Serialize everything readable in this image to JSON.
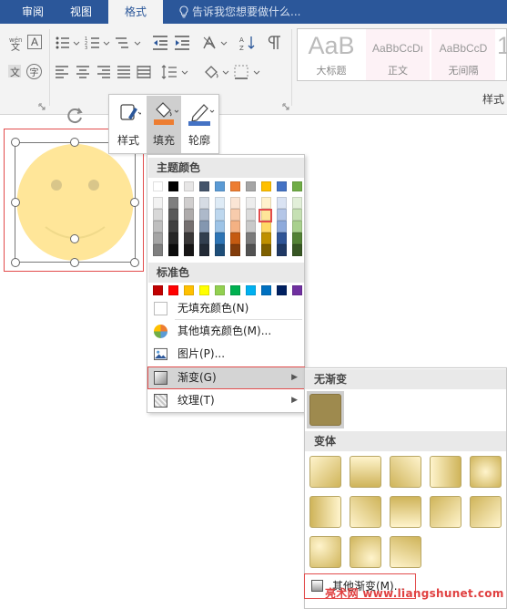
{
  "tabs": [
    {
      "label": "审阅",
      "active": false
    },
    {
      "label": "视图",
      "active": false
    },
    {
      "label": "格式",
      "active": true
    }
  ],
  "tell_me": "告诉我您想要做什么...",
  "styles_gallery": [
    {
      "preview": "AaB",
      "name": "大标题"
    },
    {
      "preview": "AaBbCcDı",
      "name": "正文"
    },
    {
      "preview": "AaBbCcD",
      "name": "无间隔"
    }
  ],
  "styles_group_label": "样式",
  "mini_toolbar": {
    "style_label": "样式",
    "fill_label": "填充",
    "outline_label": "轮廓"
  },
  "fill_menu": {
    "theme_colors_header": "主题颜色",
    "standard_colors_header": "标准色",
    "no_fill_label": "无填充颜色(N)",
    "more_colors_label": "其他填充颜色(M)...",
    "picture_label": "图片(P)...",
    "gradient_label": "渐变(G)",
    "texture_label": "纹理(T)"
  },
  "theme_colors_top": [
    "#ffffff",
    "#000000",
    "#e7e6e6",
    "#44546a",
    "#5b9bd5",
    "#ed7d31",
    "#a5a5a5",
    "#ffc000",
    "#4472c4",
    "#70ad47"
  ],
  "theme_colors_shades": [
    [
      "#f2f2f2",
      "#7f7f7f",
      "#d0cece",
      "#d6dce4",
      "#deebf6",
      "#fbe5d5",
      "#ededed",
      "#fff2cc",
      "#dae3f3",
      "#e2efd9"
    ],
    [
      "#d8d8d8",
      "#595959",
      "#aeabab",
      "#adb9ca",
      "#bdd7ee",
      "#f7cbac",
      "#dbdbdb",
      "#fee599",
      "#b4c6e7",
      "#c5e0b3"
    ],
    [
      "#bfbfbf",
      "#3f3f3f",
      "#757070",
      "#8497b0",
      "#9dc3e6",
      "#f4b183",
      "#c9c9c9",
      "#ffd965",
      "#8eaadb",
      "#a8d08d"
    ],
    [
      "#a5a5a5",
      "#262626",
      "#3a3838",
      "#323f4f",
      "#2e75b5",
      "#c55a11",
      "#7b7b7b",
      "#bf9000",
      "#2f5496",
      "#538135"
    ],
    [
      "#7f7f7f",
      "#0c0c0c",
      "#171616",
      "#222a35",
      "#1e4e79",
      "#833c0b",
      "#525252",
      "#7f6000",
      "#1f3864",
      "#375623"
    ]
  ],
  "standard_colors": [
    "#c00000",
    "#ff0000",
    "#ffc000",
    "#ffff00",
    "#92d050",
    "#00b050",
    "#00b0f0",
    "#0070c0",
    "#002060",
    "#7030a0"
  ],
  "gradient_menu": {
    "no_gradient_header": "无渐变",
    "variants_header": "变体",
    "more_gradients_label": "其他渐变(M)..."
  },
  "colors": {
    "accent_blue": "#2b579a",
    "smiley_fill": "#ffe699",
    "gradient_base": "#9e8a4e",
    "highlight_outline": "#e24c4c"
  },
  "watermark": "亮术网 www.liangshunet.com"
}
